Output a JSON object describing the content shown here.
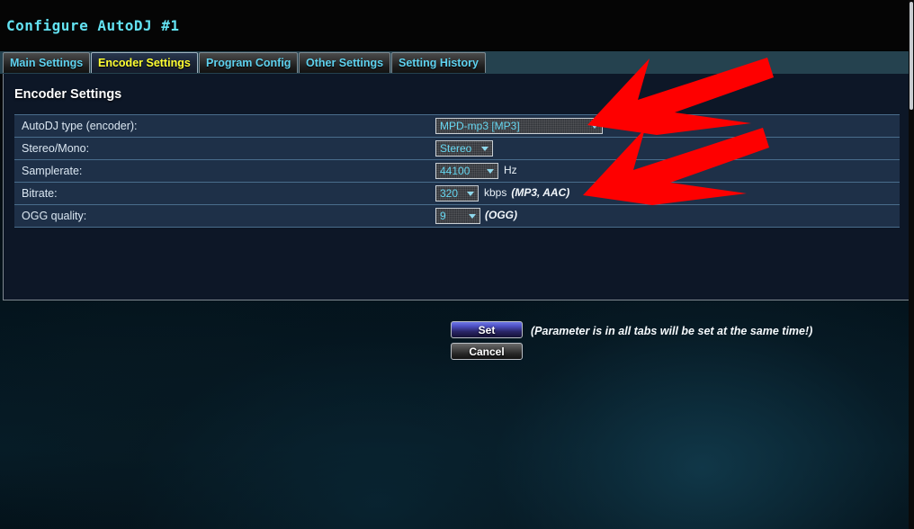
{
  "window": {
    "title": "Configure AutoDJ #1"
  },
  "tabs": [
    {
      "label": "Main Settings",
      "active": false
    },
    {
      "label": "Encoder Settings",
      "active": true
    },
    {
      "label": "Program Config",
      "active": false
    },
    {
      "label": "Other Settings",
      "active": false
    },
    {
      "label": "Setting History",
      "active": false
    }
  ],
  "panel": {
    "section_title": "Encoder Settings",
    "rows": [
      {
        "label": "AutoDJ type (encoder):",
        "control": "select",
        "value": "MPD-mp3 [MP3]",
        "unit": "",
        "hint": ""
      },
      {
        "label": "Stereo/Mono:",
        "control": "select",
        "value": "Stereo",
        "unit": "",
        "hint": ""
      },
      {
        "label": "Samplerate:",
        "control": "select",
        "value": "44100",
        "unit": "Hz",
        "hint": ""
      },
      {
        "label": "Bitrate:",
        "control": "select",
        "value": "320",
        "unit": "kbps",
        "hint": "(MP3, AAC)"
      },
      {
        "label": "OGG quality:",
        "control": "select",
        "value": "9",
        "unit": "",
        "hint": "(OGG)"
      }
    ],
    "buttons": {
      "set_label": "Set",
      "cancel_label": "Cancel",
      "note": "(Parameter is in all tabs will be set at the same time!)"
    }
  },
  "annotations": {
    "arrow_color": "#fe0000",
    "arrow_count": 2,
    "arrow1_points_to": "AutoDJ type (encoder) dropdown",
    "arrow2_points_to": "Bitrate dropdown"
  },
  "colors": {
    "title_cyan": "#63e2f2",
    "active_tab_text": "#ffff33",
    "tab_text": "#5fd2ef",
    "tabbar_bg": "#25424f",
    "panel_bg": "#0d1727",
    "row_bg": "#1e3048",
    "select_text": "#66d6f0",
    "arrow_red": "#fe0000"
  }
}
